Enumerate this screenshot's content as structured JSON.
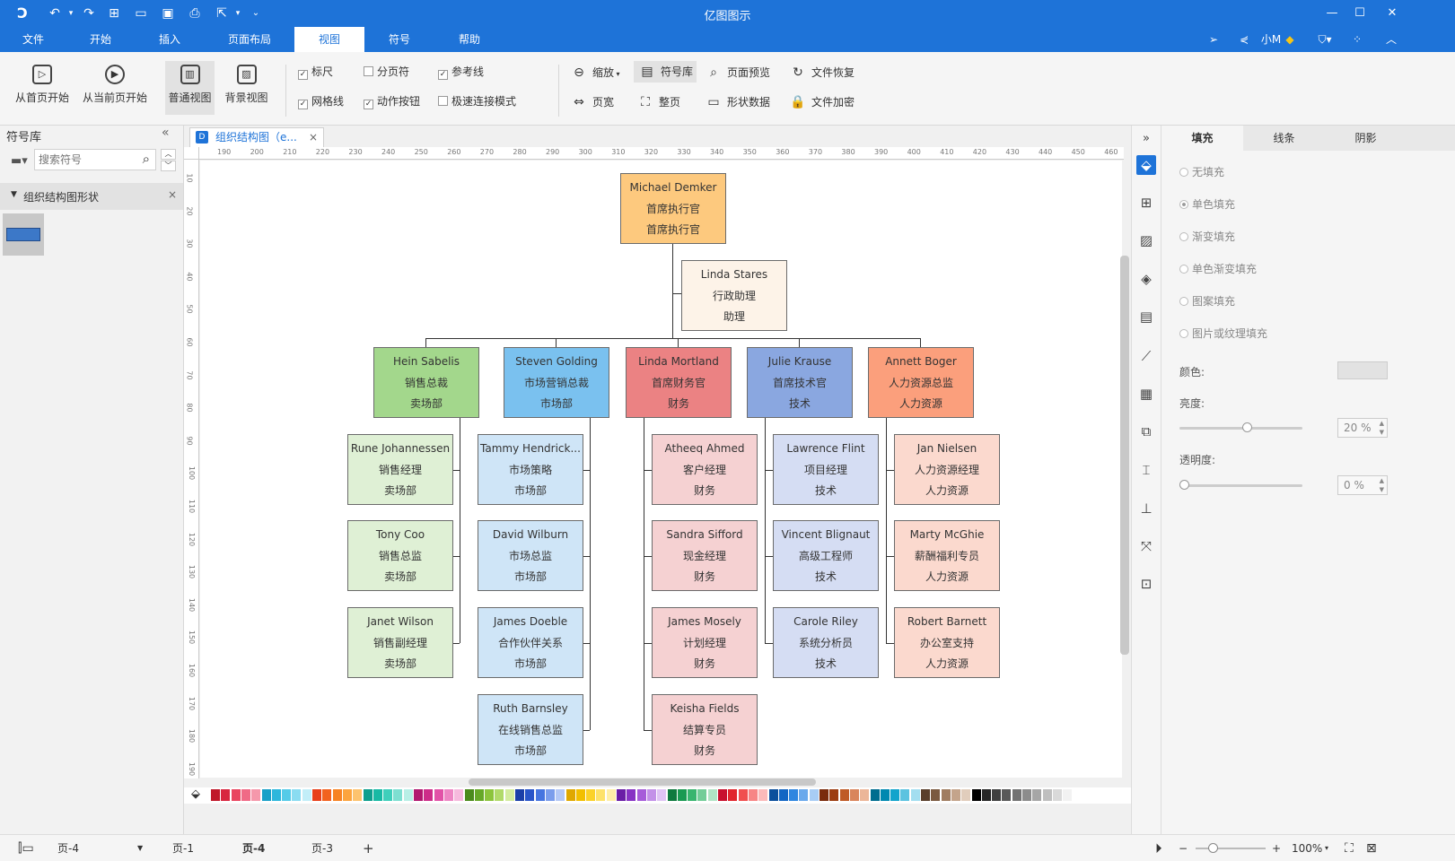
{
  "app": {
    "title": "亿图图示"
  },
  "menu": {
    "tabs": [
      "文件",
      "开始",
      "插入",
      "页面布局",
      "视图",
      "符号",
      "帮助"
    ],
    "active_tab": "视图",
    "user": "小M"
  },
  "ribbon": {
    "from_first": "从首页开始",
    "from_current": "从当前页开始",
    "normal_view": "普通视图",
    "background_view": "背景视图",
    "ruler": "标尺",
    "page_break": "分页符",
    "guide_line": "参考线",
    "grid": "网格线",
    "action_button": "动作按钮",
    "fast_connect": "极速连接模式",
    "zoom": "缩放",
    "symbol_lib": "符号库",
    "page_preview": "页面预览",
    "file_recovery": "文件恢复",
    "page_width": "页宽",
    "whole_page": "整页",
    "shape_data": "形状数据",
    "file_encrypt": "文件加密"
  },
  "left_panel": {
    "title": "符号库",
    "search_placeholder": "搜索符号",
    "category": "组织结构图形状"
  },
  "document": {
    "tab_title": "组织结构图（e..."
  },
  "ruler": {
    "top": [
      190,
      200,
      210,
      220,
      230,
      240,
      250,
      260,
      270,
      280,
      290,
      300,
      310,
      320,
      330,
      340,
      350,
      360,
      370,
      380,
      390,
      400,
      410,
      420,
      430,
      440,
      450,
      460
    ],
    "left": [
      10,
      20,
      30,
      40,
      50,
      60,
      70,
      80,
      90,
      100,
      110,
      120,
      130,
      140,
      150,
      160,
      170,
      180,
      190
    ]
  },
  "org": {
    "ceo": {
      "name": "Michael Demker",
      "title": "首席执行官",
      "dept": "首席执行官",
      "color": "#fdc97e"
    },
    "assistant": {
      "name": "Linda Stares",
      "title": "行政助理",
      "dept": "助理",
      "color": "#fdf3e8"
    },
    "columns": [
      {
        "head": {
          "name": "Hein Sabelis",
          "title": "销售总裁",
          "dept": "卖场部",
          "color": "#a3d78c"
        },
        "light": "#dff0d5",
        "members": [
          {
            "name": "Rune Johannessen",
            "title": "销售经理",
            "dept": "卖场部"
          },
          {
            "name": "Tony Coo",
            "title": "销售总监",
            "dept": "卖场部"
          },
          {
            "name": "Janet Wilson",
            "title": "销售副经理",
            "dept": "卖场部"
          }
        ]
      },
      {
        "head": {
          "name": "Steven Golding",
          "title": "市场营销总裁",
          "dept": "市场部",
          "color": "#7ac1ef"
        },
        "light": "#cfe5f7",
        "members": [
          {
            "name": "Tammy Hendrick...",
            "title": "市场策略",
            "dept": "市场部"
          },
          {
            "name": "David Wilburn",
            "title": "市场总监",
            "dept": "市场部"
          },
          {
            "name": "James Doeble",
            "title": "合作伙伴关系",
            "dept": "市场部"
          },
          {
            "name": "Ruth Barnsley",
            "title": "在线销售总监",
            "dept": "市场部"
          }
        ]
      },
      {
        "head": {
          "name": "Linda Mortland",
          "title": "首席财务官",
          "dept": "财务",
          "color": "#eb8283"
        },
        "light": "#f5d1d2",
        "members": [
          {
            "name": "Atheeq Ahmed",
            "title": "客户经理",
            "dept": "财务"
          },
          {
            "name": "Sandra Sifford",
            "title": "现金经理",
            "dept": "财务"
          },
          {
            "name": "James Mosely",
            "title": "计划经理",
            "dept": "财务"
          },
          {
            "name": "Keisha Fields",
            "title": "结算专员",
            "dept": "财务"
          }
        ]
      },
      {
        "head": {
          "name": "Julie Krause",
          "title": "首席技术官",
          "dept": "技术",
          "color": "#8aa7e0"
        },
        "light": "#d5ddf3",
        "members": [
          {
            "name": "Lawrence Flint",
            "title": "项目经理",
            "dept": "技术"
          },
          {
            "name": "Vincent Blignaut",
            "title": "高级工程师",
            "dept": "技术"
          },
          {
            "name": "Carole Riley",
            "title": "系统分析员",
            "dept": "技术"
          }
        ]
      },
      {
        "head": {
          "name": "Annett Boger",
          "title": "人力资源总监",
          "dept": "人力资源",
          "color": "#fb9f7c"
        },
        "light": "#fbd9ce",
        "members": [
          {
            "name": "Jan Nielsen",
            "title": "人力资源经理",
            "dept": "人力资源"
          },
          {
            "name": "Marty McGhie",
            "title": "薪酬福利专员",
            "dept": "人力资源"
          },
          {
            "name": "Robert Barnett",
            "title": "办公室支持",
            "dept": "人力资源"
          }
        ]
      }
    ]
  },
  "palette": [
    "#c0182a",
    "#d8263f",
    "#e94560",
    "#f06a86",
    "#f598ab",
    "#1aa1c8",
    "#2db7dc",
    "#55cbe8",
    "#8adcf1",
    "#c2eef8",
    "#e8401a",
    "#f2621f",
    "#f78323",
    "#fca43e",
    "#fdc36e",
    "#0e9f8e",
    "#18b9a4",
    "#3fcfbb",
    "#7ddfd1",
    "#b8efe6",
    "#b1186f",
    "#cd2d89",
    "#e252a7",
    "#ee86c4",
    "#f6b9dd",
    "#4b8b1b",
    "#66a827",
    "#8cc43c",
    "#b1da6a",
    "#d4ec9f",
    "#1b3fa8",
    "#2955c9",
    "#4675e0",
    "#7b9dec",
    "#b4c8f6",
    "#e0a800",
    "#f2bf00",
    "#fbd22a",
    "#fde26a",
    "#feefa8",
    "#6a1ea6",
    "#8733c4",
    "#a65cd9",
    "#c391e8",
    "#dfc4f4",
    "#0f7a3e",
    "#1a9a52",
    "#39b56f",
    "#74cd99",
    "#b0e4c5",
    "#c8102e",
    "#e1262d",
    "#f04f4f",
    "#f78585",
    "#fbbaba",
    "#0b4f9c",
    "#1366c4",
    "#2f86e0",
    "#6aa9ec",
    "#a8cdf5",
    "#7a2b0c",
    "#9c3d12",
    "#bf5a26",
    "#d9855c",
    "#ecb699",
    "#006d8f",
    "#0088b0",
    "#12a4cc",
    "#5cc3e0",
    "#a3def0",
    "#5a3e2b",
    "#7b5a40",
    "#a07d61",
    "#c4a48b",
    "#e1cdbc",
    "#000000",
    "#262626",
    "#404040",
    "#595959",
    "#737373",
    "#8c8c8c",
    "#a6a6a6",
    "#bfbfbf",
    "#d9d9d9",
    "#f2f2f2"
  ],
  "props": {
    "tabs": [
      "填充",
      "线条",
      "阴影"
    ],
    "fill_options": [
      "无填充",
      "单色填充",
      "渐变填充",
      "单色渐变填充",
      "图案填充",
      "图片或纹理填充"
    ],
    "color_label": "颜色:",
    "brightness_label": "亮度:",
    "brightness_value": "20 %",
    "brightness_level": 0.55,
    "opacity_label": "透明度:",
    "opacity_value": "0 %",
    "opacity_level": 0
  },
  "status": {
    "page_select": "页-4",
    "pages": [
      "页-1",
      "页-4",
      "页-3"
    ],
    "active_page": "页-4",
    "add": "+",
    "zoom": "100%"
  }
}
